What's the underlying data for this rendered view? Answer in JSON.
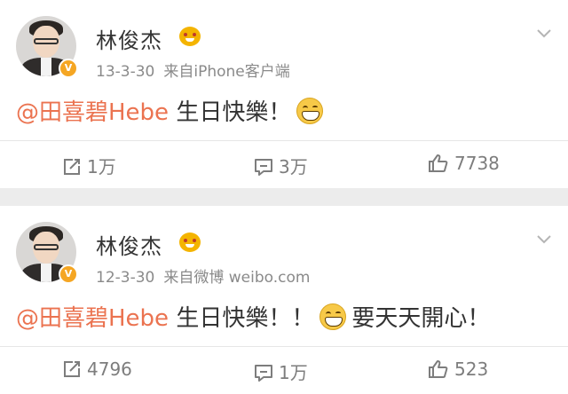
{
  "posts": [
    {
      "author": "林俊杰",
      "date": "13-3-30",
      "source": "来自iPhone客户端",
      "mention": "@田喜碧Hebe",
      "text_before_emoji": " 生日快樂！",
      "text_after_emoji": "",
      "repost_count": "1万",
      "comment_count": "3万",
      "like_count": "7738"
    },
    {
      "author": "林俊杰",
      "date": "12-3-30",
      "source": "来自微博 weibo.com",
      "mention": "@田喜碧Hebe",
      "text_before_emoji": " 生日快樂！！",
      "text_after_emoji": "要天天開心！",
      "repost_count": "4796",
      "comment_count": "1万",
      "like_count": "523"
    }
  ],
  "icons": {
    "verified_badge": "verified-v-icon",
    "vip": "vip-crown-icon",
    "emoji": "grin-emoji-icon",
    "repost": "repost-icon",
    "comment": "comment-icon",
    "like": "thumbs-up-icon",
    "menu": "chevron-down-icon"
  },
  "colors": {
    "mention": "#eb7350",
    "verified": "#f5a623"
  }
}
